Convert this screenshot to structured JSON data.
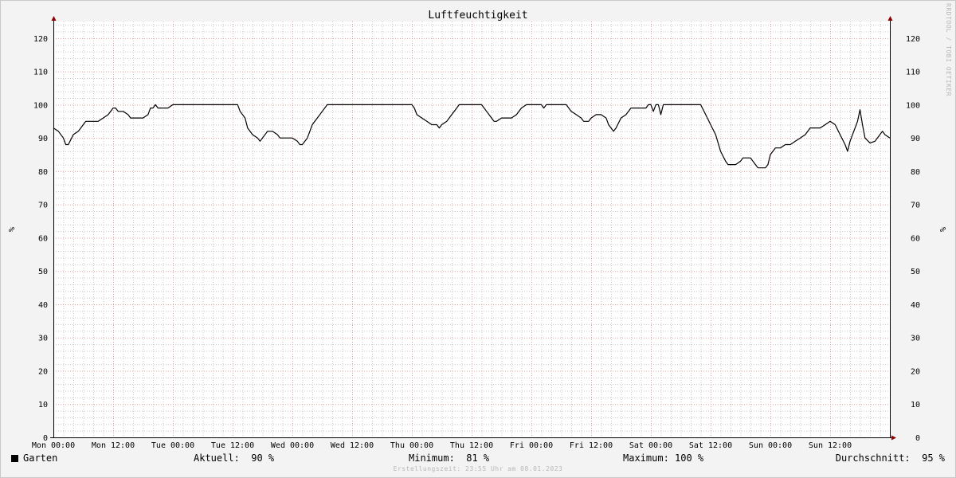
{
  "chart_data": {
    "type": "line",
    "title": "Luftfeuchtigkeit",
    "ylabel": "%",
    "ylabel_right": "%",
    "ylim": [
      0,
      125
    ],
    "yticks": [
      0,
      10,
      20,
      30,
      40,
      50,
      60,
      70,
      80,
      90,
      100,
      110,
      120
    ],
    "xticks": [
      "Mon 00:00",
      "Mon 12:00",
      "Tue 00:00",
      "Tue 12:00",
      "Wed 00:00",
      "Wed 12:00",
      "Thu 00:00",
      "Thu 12:00",
      "Fri 00:00",
      "Fri 12:00",
      "Sat 00:00",
      "Sat 12:00",
      "Sun 00:00",
      "Sun 12:00"
    ],
    "x_unit": "hours since Mon 00:00",
    "xlim": [
      0,
      168
    ],
    "grid": true,
    "series": [
      {
        "name": "Garten",
        "color": "#000000",
        "points": [
          [
            0,
            93
          ],
          [
            1,
            92
          ],
          [
            2,
            90
          ],
          [
            2.5,
            88
          ],
          [
            3,
            88
          ],
          [
            4,
            91
          ],
          [
            5,
            92
          ],
          [
            6,
            94
          ],
          [
            6.5,
            95
          ],
          [
            8,
            95
          ],
          [
            9,
            95
          ],
          [
            10,
            96
          ],
          [
            11,
            97
          ],
          [
            12,
            99
          ],
          [
            12.5,
            99
          ],
          [
            13,
            98
          ],
          [
            14,
            98
          ],
          [
            15,
            97
          ],
          [
            15.5,
            96
          ],
          [
            18,
            96
          ],
          [
            19,
            97
          ],
          [
            19.5,
            99
          ],
          [
            20,
            99
          ],
          [
            20.5,
            100
          ],
          [
            21,
            99
          ],
          [
            23,
            99
          ],
          [
            24,
            100
          ],
          [
            30,
            100
          ],
          [
            36,
            100
          ],
          [
            37,
            100
          ],
          [
            37.5,
            98
          ],
          [
            38.5,
            96
          ],
          [
            39,
            93
          ],
          [
            40,
            91
          ],
          [
            41,
            90
          ],
          [
            41.5,
            89
          ],
          [
            42,
            90
          ],
          [
            43,
            92
          ],
          [
            44,
            92
          ],
          [
            45,
            91
          ],
          [
            45.5,
            90
          ],
          [
            48,
            90
          ],
          [
            49,
            89
          ],
          [
            49.5,
            88
          ],
          [
            50,
            88
          ],
          [
            51,
            90
          ],
          [
            52,
            94
          ],
          [
            53,
            96
          ],
          [
            54,
            98
          ],
          [
            55,
            100
          ],
          [
            60,
            100
          ],
          [
            66,
            100
          ],
          [
            72,
            100
          ],
          [
            72.5,
            99
          ],
          [
            73,
            97
          ],
          [
            74,
            96
          ],
          [
            75,
            95
          ],
          [
            76,
            94
          ],
          [
            77,
            94
          ],
          [
            77.5,
            93
          ],
          [
            78,
            94
          ],
          [
            79,
            95
          ],
          [
            80,
            97
          ],
          [
            81,
            99
          ],
          [
            81.5,
            100
          ],
          [
            86,
            100
          ],
          [
            87,
            98
          ],
          [
            88,
            96
          ],
          [
            88.5,
            95
          ],
          [
            89,
            95
          ],
          [
            90,
            96
          ],
          [
            92,
            96
          ],
          [
            93,
            97
          ],
          [
            94,
            99
          ],
          [
            95,
            100
          ],
          [
            98,
            100
          ],
          [
            98.5,
            99
          ],
          [
            99,
            100
          ],
          [
            103,
            100
          ],
          [
            104,
            98
          ],
          [
            105,
            97
          ],
          [
            106,
            96
          ],
          [
            106.5,
            95
          ],
          [
            107.5,
            95
          ],
          [
            108,
            96
          ],
          [
            109,
            97
          ],
          [
            110,
            97
          ],
          [
            111,
            96
          ],
          [
            111.5,
            94
          ],
          [
            112,
            93
          ],
          [
            112.5,
            92
          ],
          [
            113,
            93
          ],
          [
            114,
            96
          ],
          [
            115,
            97
          ],
          [
            116,
            99
          ],
          [
            117.5,
            99
          ],
          [
            119,
            99
          ],
          [
            119.5,
            100
          ],
          [
            120,
            100
          ],
          [
            120.5,
            98
          ],
          [
            121,
            100
          ],
          [
            121.5,
            100
          ],
          [
            122,
            97
          ],
          [
            122.5,
            100
          ],
          [
            130,
            100
          ],
          [
            131,
            97
          ],
          [
            132,
            94
          ],
          [
            133,
            91
          ],
          [
            134,
            86
          ],
          [
            135,
            83
          ],
          [
            135.5,
            82
          ],
          [
            137,
            82
          ],
          [
            138,
            83
          ],
          [
            138.5,
            84
          ],
          [
            140,
            84
          ],
          [
            141,
            82
          ],
          [
            141.5,
            81
          ],
          [
            143,
            81
          ],
          [
            143.5,
            82
          ],
          [
            144,
            85
          ],
          [
            145,
            87
          ],
          [
            146,
            87
          ],
          [
            147,
            88
          ],
          [
            148,
            88
          ],
          [
            149,
            89
          ],
          [
            150,
            90
          ],
          [
            151,
            91
          ],
          [
            152,
            93
          ],
          [
            153,
            93
          ],
          [
            154,
            93
          ],
          [
            155,
            94
          ],
          [
            156,
            95
          ],
          [
            157,
            94
          ],
          [
            158,
            91
          ],
          [
            159,
            88
          ],
          [
            159.5,
            86
          ],
          [
            160,
            89
          ],
          [
            161,
            93
          ],
          [
            161.5,
            95
          ],
          [
            162,
            98.5
          ],
          [
            162.5,
            94
          ],
          [
            163,
            90
          ],
          [
            164,
            88.5
          ],
          [
            165,
            89
          ],
          [
            166,
            91
          ],
          [
            166.5,
            92
          ],
          [
            167,
            91
          ],
          [
            167.5,
            90.5
          ],
          [
            168,
            90
          ]
        ]
      }
    ]
  },
  "legend": {
    "series_name": "Garten",
    "current": "Aktuell:  90 %",
    "minimum": "Minimum:  81 %",
    "maximum": "Maximum: 100 %",
    "average": "Durchschnitt:  95 %"
  },
  "footer": "Erstellungszeit: 23:55 Uhr am 08.01.2023",
  "watermark": "RRDTOOL / TOBI OETIKER",
  "colors": {
    "background": "#f3f3f3",
    "plot_background": "#ffffff",
    "minor_grid": "#c8c8c8",
    "major_grid": "#e6a0a0",
    "axis_arrow": "#8b0000",
    "line": "#000000"
  }
}
